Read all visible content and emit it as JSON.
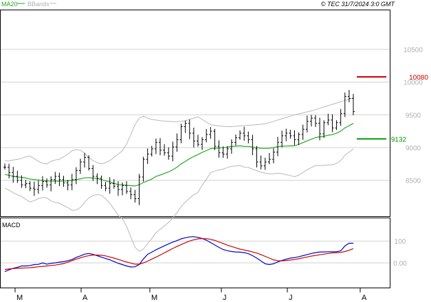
{
  "header": {
    "ma_label": "MA20",
    "bb_label": "BBands",
    "copyright": "© TEC 31/7/2024 3:0 GMT"
  },
  "colors": {
    "panel_bg": "#ffffff",
    "grid": "#d0d0d0",
    "axis_text": "#b0b0b0",
    "price_bars": "#000000",
    "ma": "#22aa22",
    "bbands": "#b8b8b8",
    "macd": "#0000cc",
    "signal": "#cc0000",
    "resistance": "#cc0000",
    "support": "#009900"
  },
  "chart_data": [
    {
      "type": "ohlc",
      "name": "price",
      "ylim": [
        8100,
        10900
      ],
      "y_ticks": [
        8500,
        9000,
        9500,
        10000,
        10500
      ],
      "y_tick_labels": [
        "8500",
        "9000",
        "9500",
        "10000",
        "10500"
      ],
      "x_ticks": [
        "M",
        "A",
        "M",
        "J",
        "J",
        "A"
      ],
      "grid": true,
      "legend": [
        "MA20",
        "BBands"
      ],
      "levels": [
        {
          "label": "10080",
          "value": 10080,
          "color": "#cc0000"
        },
        {
          "label": "9132",
          "value": 9132,
          "color": "#009900"
        }
      ],
      "close": [
        8700,
        8620,
        8560,
        8500,
        8430,
        8450,
        8380,
        8360,
        8420,
        8480,
        8430,
        8510,
        8560,
        8510,
        8460,
        8430,
        8510,
        8650,
        8780,
        8850,
        8680,
        8560,
        8530,
        8420,
        8380,
        8450,
        8410,
        8360,
        8420,
        8330,
        8280,
        8220,
        8550,
        8820,
        8900,
        8980,
        9080,
        8960,
        8920,
        8870,
        9010,
        9120,
        9320,
        9370,
        9220,
        9100,
        9050,
        9120,
        9200,
        9250,
        9020,
        8920,
        8900,
        8980,
        9080,
        9150,
        9220,
        9180,
        9120,
        8980,
        8780,
        8720,
        8780,
        8820,
        8930,
        9080,
        9180,
        9220,
        9180,
        9120,
        9200,
        9280,
        9400,
        9450,
        9370,
        9210,
        9380,
        9420,
        9300,
        9380,
        9520,
        9780,
        9750,
        9550
      ],
      "ma20": [
        8590,
        8575,
        8560,
        8550,
        8545,
        8535,
        8520,
        8510,
        8505,
        8498,
        8490,
        8488,
        8487,
        8486,
        8488,
        8492,
        8497,
        8508,
        8523,
        8537,
        8541,
        8534,
        8526,
        8512,
        8493,
        8476,
        8455,
        8434,
        8431,
        8424,
        8418,
        8414,
        8432,
        8465,
        8491,
        8520,
        8560,
        8581,
        8605,
        8628,
        8660,
        8700,
        8750,
        8789,
        8829,
        8865,
        8893,
        8928,
        8953,
        8983,
        8990,
        8994,
        8998,
        9007,
        9017,
        9022,
        9027,
        9018,
        9018,
        9008,
        8999,
        8989,
        8987,
        8989,
        9001,
        9014,
        9021,
        9023,
        9026,
        9027,
        9048,
        9075,
        9103,
        9127,
        9152,
        9163,
        9173,
        9188,
        9198,
        9219,
        9251,
        9302,
        9334,
        9370
      ],
      "bb_upper": [
        8800,
        8800,
        8810,
        8820,
        8835,
        8860,
        8870,
        8830,
        8790,
        8760,
        8750,
        8790,
        8810,
        8820,
        8860,
        8900,
        8950,
        8970,
        8960,
        8910,
        8850,
        8800,
        8770,
        8750,
        8770,
        8800,
        8850,
        8900,
        8950,
        9050,
        9200,
        9350,
        9450,
        9480,
        9450,
        9430,
        9420,
        9410,
        9405,
        9400,
        9395,
        9395,
        9400,
        9410,
        9430,
        9450,
        9470,
        9430,
        9390,
        9350,
        9340,
        9330,
        9325,
        9320,
        9320,
        9325,
        9330,
        9335,
        9340,
        9345,
        9350,
        9355,
        9365,
        9380,
        9400,
        9420,
        9440,
        9460,
        9480,
        9500,
        9515,
        9530,
        9545,
        9560,
        9580,
        9600,
        9620,
        9640,
        9660,
        9680,
        9700,
        9720,
        9740,
        9760
      ],
      "bb_lower": [
        8380,
        8350,
        8310,
        8280,
        8255,
        8210,
        8170,
        8190,
        8220,
        8236,
        8230,
        8186,
        8164,
        8152,
        8116,
        8084,
        8044,
        8046,
        8086,
        8164,
        8232,
        8268,
        8282,
        8274,
        8216,
        8152,
        8060,
        7968,
        7912,
        7798,
        7636,
        7478,
        7414,
        7450,
        7532,
        7610,
        7700,
        7752,
        7805,
        7856,
        7925,
        8005,
        8100,
        8168,
        8228,
        8280,
        8316,
        8426,
        8516,
        8616,
        8640,
        8658,
        8671,
        8694,
        8714,
        8719,
        8724,
        8701,
        8696,
        8671,
        8648,
        8623,
        8609,
        8598,
        8602,
        8608,
        8602,
        8586,
        8572,
        8554,
        8581,
        8620,
        8661,
        8694,
        8724,
        8726,
        8726,
        8736,
        8736,
        8758,
        8802,
        8884,
        8928,
        8980
      ]
    },
    {
      "type": "line",
      "name": "macd_panel",
      "title": "MACD",
      "ylim": [
        -60,
        130
      ],
      "y_ticks": [
        0,
        100
      ],
      "y_tick_labels": [
        "0.00",
        "100"
      ],
      "grid": true,
      "series": [
        {
          "name": "MACD",
          "color": "#0000cc",
          "values": [
            -40,
            -32,
            -25,
            -20,
            -14,
            -14,
            -12,
            -8,
            -7,
            0,
            -6,
            -2,
            0,
            3,
            6,
            10,
            15,
            25,
            32,
            40,
            43,
            39,
            33,
            26,
            20,
            14,
            6,
            -2,
            -8,
            -14,
            -19,
            -18,
            -8,
            18,
            39,
            49,
            60,
            69,
            78,
            87,
            95,
            102,
            110,
            115,
            119,
            120,
            117,
            112,
            104,
            93,
            82,
            71,
            61,
            56,
            52,
            50,
            49,
            47,
            42,
            33,
            22,
            9,
            -4,
            -8,
            -4,
            4,
            11,
            17,
            22,
            24,
            28,
            33,
            38,
            43,
            47,
            50,
            50,
            51,
            51,
            51,
            55,
            78,
            90,
            90
          ]
        },
        {
          "name": "Signal",
          "color": "#cc0000",
          "values": [
            -30,
            -28,
            -26,
            -25,
            -24,
            -23,
            -22,
            -20,
            -18,
            -16,
            -14,
            -12,
            -10,
            -7,
            -3,
            3,
            10,
            17,
            23,
            29,
            33,
            36,
            36,
            35,
            32,
            27,
            22,
            16,
            10,
            4,
            -1,
            -6,
            -6,
            0,
            8,
            17,
            26,
            36,
            46,
            56,
            66,
            75,
            84,
            92,
            100,
            106,
            110,
            111,
            111,
            108,
            103,
            96,
            89,
            81,
            75,
            69,
            63,
            59,
            55,
            50,
            45,
            38,
            30,
            22,
            14,
            10,
            9,
            11,
            13,
            15,
            19,
            23,
            27,
            31,
            34,
            37,
            40,
            43,
            46,
            47,
            48,
            52,
            58,
            65
          ]
        }
      ]
    }
  ]
}
